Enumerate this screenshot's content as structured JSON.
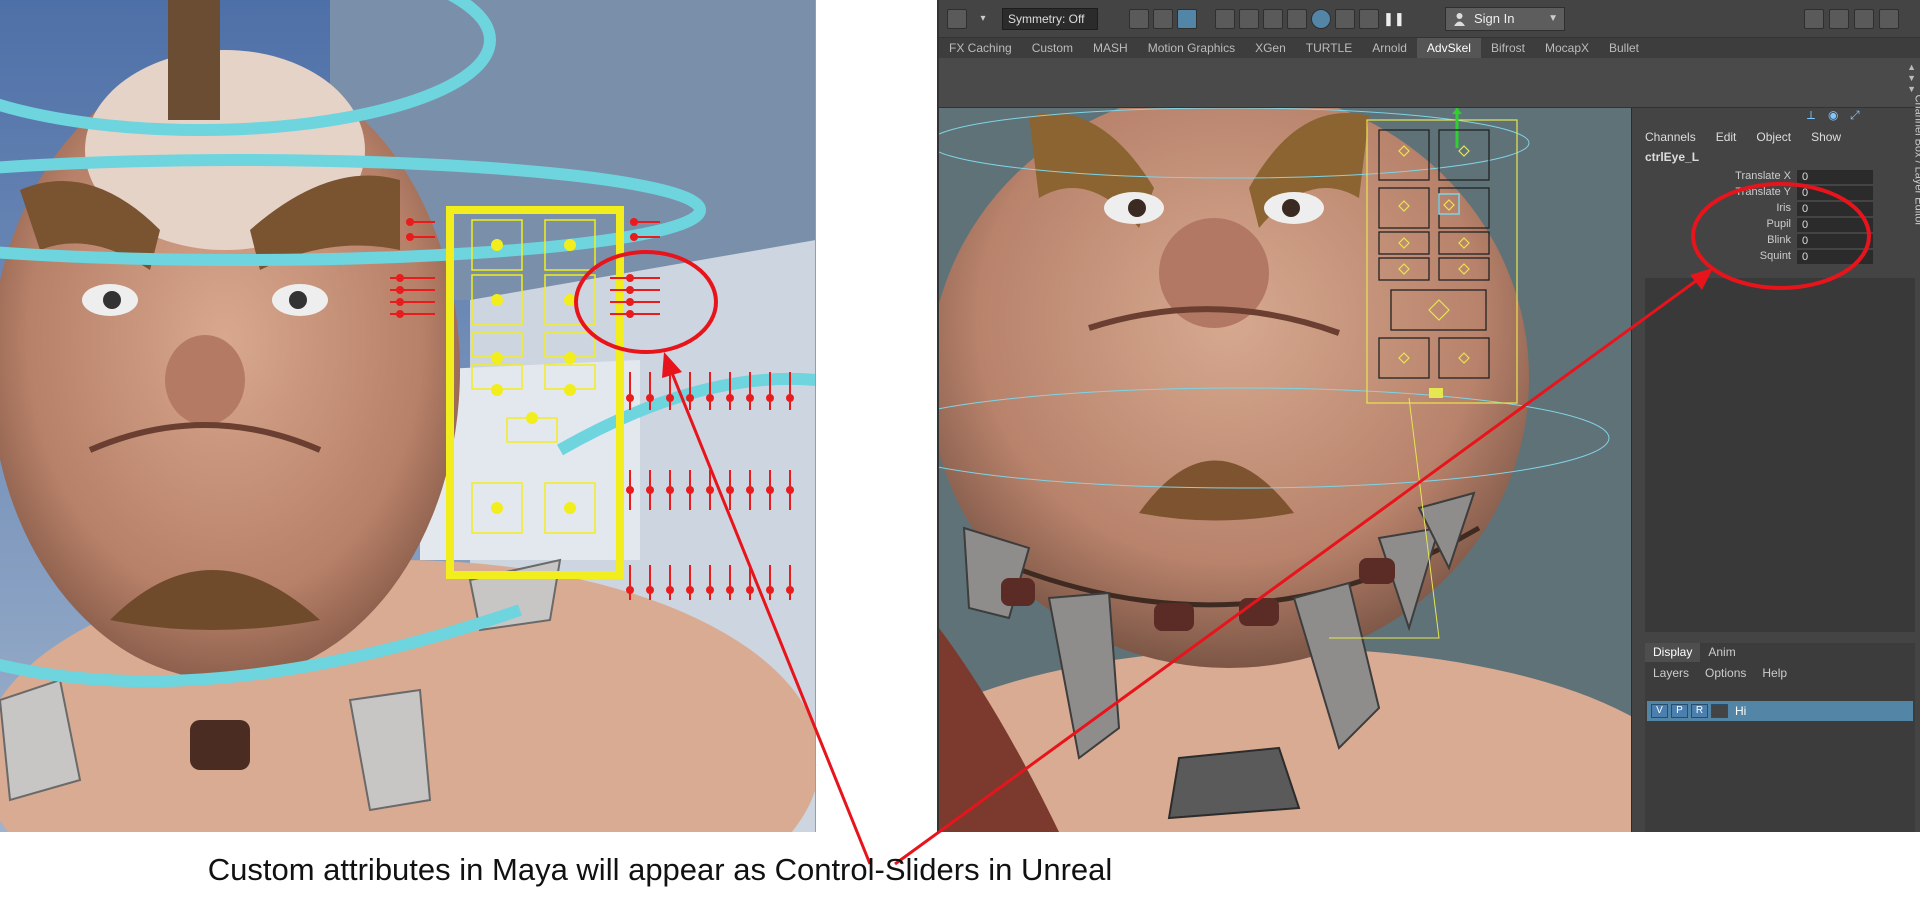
{
  "caption": "Custom attributes in Maya will appear as Control-Sliders in Unreal",
  "colors": {
    "callout": "#e8141c",
    "ue_controls": "#f2ee1e",
    "ue_sliders": "#e81c1c",
    "ue_rings": "#6ed4de",
    "maya_selection": "#5285a6",
    "maya_controls_frame": "#e6e651"
  },
  "maya": {
    "toolbar": {
      "symmetry_label": "Symmetry: Off",
      "sign_in_label": "Sign In"
    },
    "shelf_tabs": [
      "FX Caching",
      "Custom",
      "MASH",
      "Motion Graphics",
      "XGen",
      "TURTLE",
      "Arnold",
      "AdvSkel",
      "Bifrost",
      "MocapX",
      "Bullet"
    ],
    "active_shelf_tab": "AdvSkel",
    "channel_box": {
      "menu": [
        "Channels",
        "Edit",
        "Object",
        "Show"
      ],
      "object_name": "ctrlEye_L",
      "attributes": [
        {
          "name": "Translate X",
          "value": "0"
        },
        {
          "name": "Translate Y",
          "value": "0"
        },
        {
          "name": "Iris",
          "value": "0"
        },
        {
          "name": "Pupil",
          "value": "0"
        },
        {
          "name": "Blink",
          "value": "0"
        },
        {
          "name": "Squint",
          "value": "0"
        }
      ],
      "side_label": "Channel Box / Layer Editor"
    },
    "layer_editor": {
      "tabs": [
        "Display",
        "Anim"
      ],
      "active_tab": "Display",
      "menu": [
        "Layers",
        "Options",
        "Help"
      ],
      "layer": {
        "v": "V",
        "p": "P",
        "r": "R",
        "name": "Hi"
      }
    }
  },
  "icons": [
    "user-icon",
    "chevron-down-icon",
    "camera-icon",
    "grid-icon",
    "scroll-arrows-icon",
    "axis-icon"
  ]
}
